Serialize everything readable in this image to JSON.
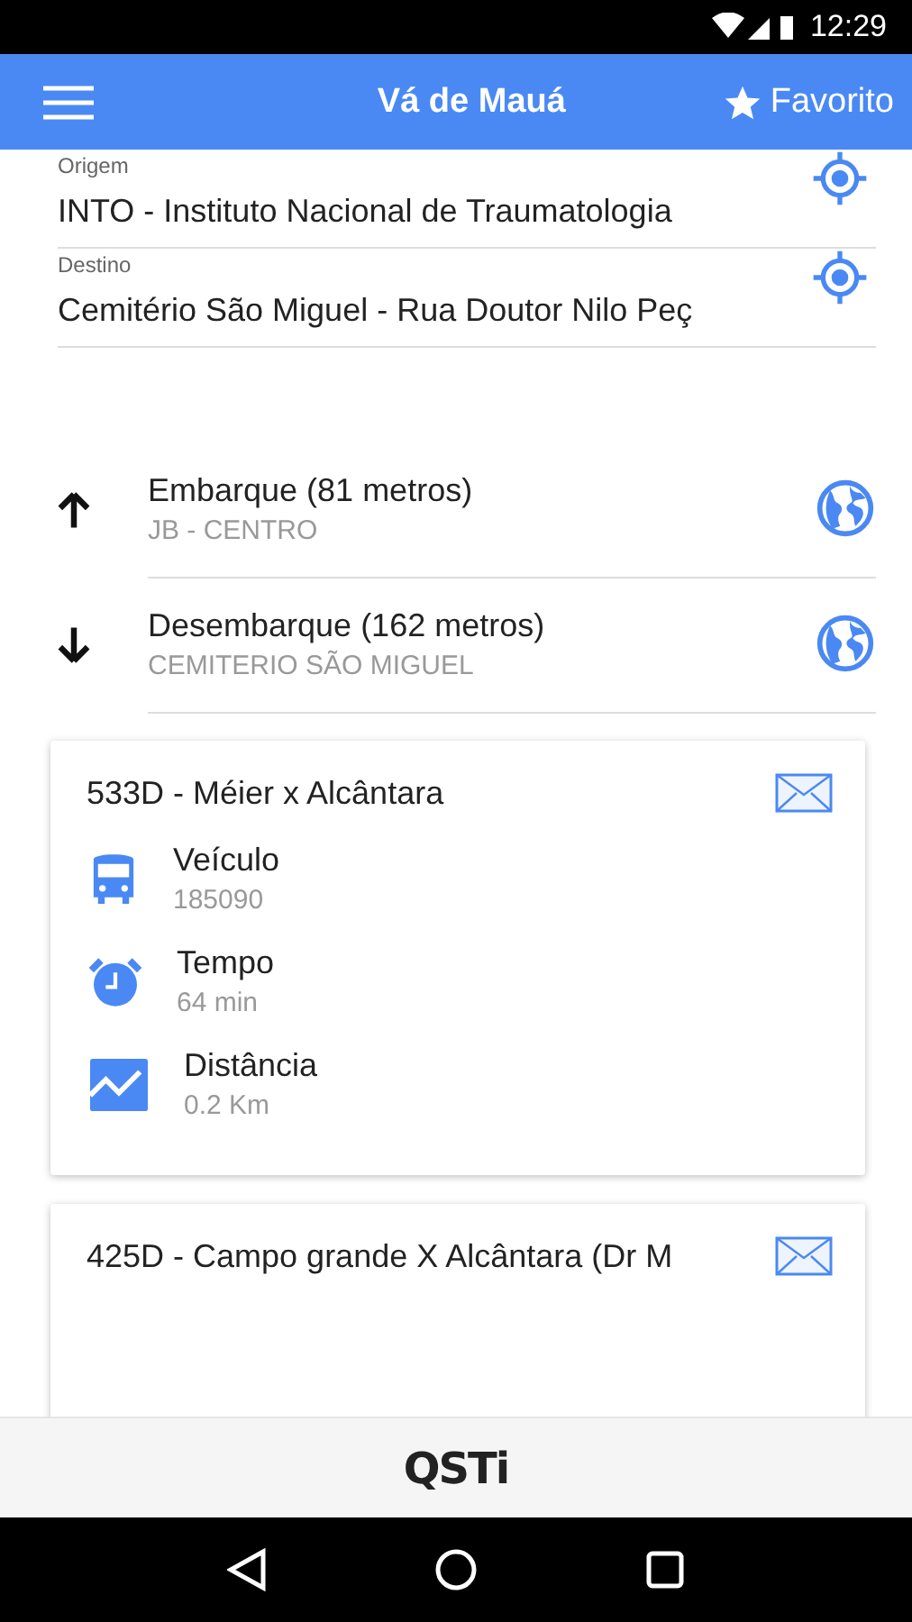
{
  "status_bar": {
    "time": "12:29"
  },
  "app_bar": {
    "title": "Vá de Mauá",
    "action": "Favorito"
  },
  "fields": [
    {
      "label": "Origem",
      "value": "INTO - Instituto Nacional de Traumatologia"
    },
    {
      "label": "Destino",
      "value": "Cemitério São Miguel - Rua Doutor Nilo Peç"
    }
  ],
  "stops": [
    {
      "kind": "up",
      "title": "Embarque (81 metros)",
      "subtitle": "JB - CENTRO"
    },
    {
      "kind": "down",
      "title": "Desembarque (162 metros)",
      "subtitle": "CEMITERIO SÃO MIGUEL"
    }
  ],
  "cards": [
    {
      "title": "533D - Méier x Alcântara",
      "details": [
        {
          "kind": "bus",
          "label": "Veículo",
          "value": "185090"
        },
        {
          "kind": "alarm",
          "label": "Tempo",
          "value": "64 min"
        },
        {
          "kind": "chart",
          "label": "Distância",
          "value": "0.2 Km"
        }
      ]
    },
    {
      "title": "425D - Campo grande X Alcântara (Dr M"
    }
  ],
  "footer": {
    "logo": "QSTi"
  }
}
